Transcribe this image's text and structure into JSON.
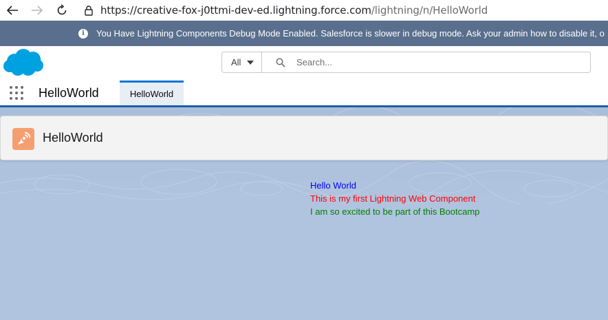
{
  "browser": {
    "url_host": "https://creative-fox-j0ttmi-dev-ed.lightning.force.com",
    "url_path": "/lightning/n/HelloWorld"
  },
  "debug_banner": {
    "message": "You Have Lightning Components Debug Mode Enabled. Salesforce is slower in debug mode. Ask your admin how to disable it, o"
  },
  "header": {
    "search": {
      "scope_label": "All",
      "placeholder": "Search..."
    }
  },
  "navbar": {
    "app_name": "HelloWorld",
    "tabs": [
      {
        "label": "HelloWorld",
        "active": true
      }
    ]
  },
  "page_header": {
    "title": "HelloWorld",
    "icon": "broadcast-icon"
  },
  "component": {
    "line1": "Hello World",
    "line2": "This is my first Lightning Web Component",
    "line3": "I am so excited to be part of this Bootcamp"
  },
  "colors": {
    "debug_banner_bg": "#5a6f8e",
    "brand_blue": "#0176d3",
    "page_icon_bg": "#f59f71",
    "text_blue": "#0000ff",
    "text_red": "#ff0000",
    "text_green": "#008000"
  }
}
